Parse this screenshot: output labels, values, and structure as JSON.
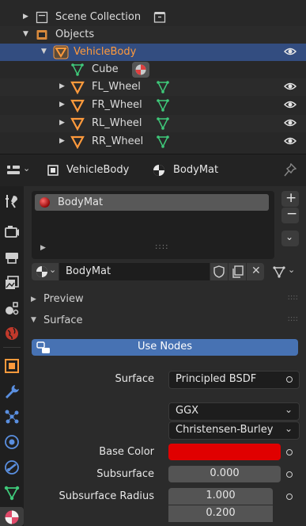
{
  "outliner": {
    "rows": [
      {
        "label": "Scene Collection"
      },
      {
        "label": "Objects"
      },
      {
        "label": "VehicleBody"
      },
      {
        "label": "Cube"
      },
      {
        "label": "FL_Wheel"
      },
      {
        "label": "FR_Wheel"
      },
      {
        "label": "RL_Wheel"
      },
      {
        "label": "RR_Wheel"
      }
    ]
  },
  "header": {
    "object_name": "VehicleBody",
    "material_name": "BodyMat"
  },
  "material": {
    "slots": [
      {
        "label": "BodyMat"
      }
    ],
    "datablock": "BodyMat"
  },
  "panels": {
    "preview": "Preview",
    "surface": "Surface",
    "use_nodes": "Use Nodes"
  },
  "surface": {
    "surface_label": "Surface",
    "surface_value": "Principled BSDF",
    "distribution": "GGX",
    "subsurface_method": "Christensen-Burley",
    "base_color_label": "Base Color",
    "base_color": "#e00000",
    "subsurface_label": "Subsurface",
    "subsurface_value": "0.000",
    "subsurface_radius_label": "Subsurface Radius",
    "subsurface_radius": [
      "1.000",
      "0.200"
    ]
  },
  "colors": {
    "accent_blue": "#4772b3",
    "selection": "#334d80",
    "object_orange": "#ff9a3c",
    "mesh_green": "#3fc97a"
  }
}
